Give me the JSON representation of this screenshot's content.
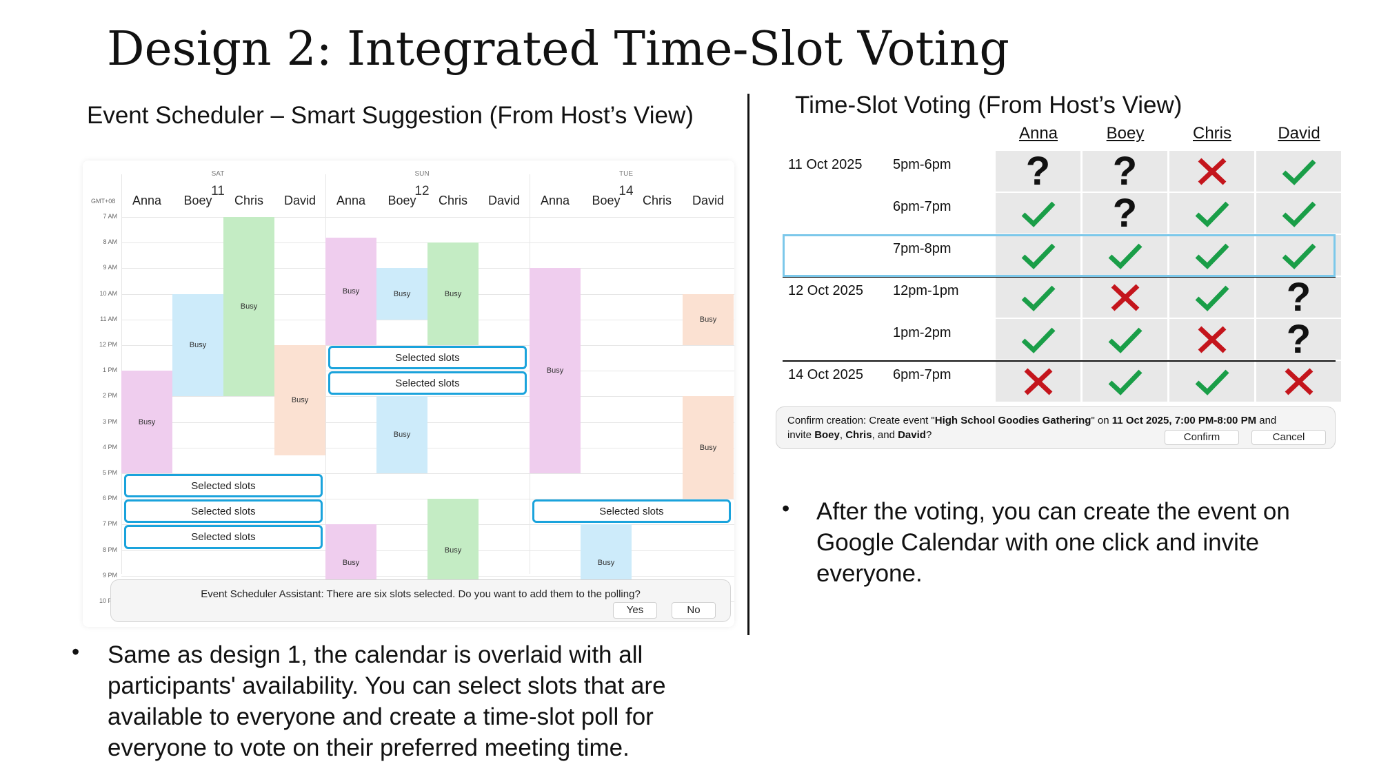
{
  "slide_title": "Design 2: Integrated Time-Slot Voting",
  "left_section": {
    "heading": "Event Scheduler – Smart Suggestion (From Host’s View)",
    "calendar": {
      "timezone": "GMT+08",
      "days": [
        {
          "weekday": "SAT",
          "date": "11"
        },
        {
          "weekday": "SUN",
          "date": "12"
        },
        {
          "weekday": "TUE",
          "date": "14"
        }
      ],
      "participants": [
        "Anna",
        "Boey",
        "Chris",
        "David"
      ],
      "hours": [
        "7 AM",
        "8 AM",
        "9 AM",
        "10 AM",
        "11 AM",
        "12 PM",
        "1 PM",
        "2 PM",
        "3 PM",
        "4 PM",
        "5 PM",
        "6 PM",
        "7 PM",
        "8 PM",
        "9 PM",
        "10 PM"
      ],
      "busy_label": "Busy",
      "selected_label": "Selected slots",
      "colors": {
        "Anna": "#efcdee",
        "Boey": "#cdebfa",
        "Chris": "#c4ecc4",
        "David": "#fbe1d2",
        "selected_border": "#1aa3dc"
      },
      "busy_blocks": [
        {
          "day": 0,
          "person": "Anna",
          "start": 13,
          "end": 17
        },
        {
          "day": 0,
          "person": "Boey",
          "start": 10,
          "end": 14
        },
        {
          "day": 0,
          "person": "Chris",
          "start": 7,
          "end": 14
        },
        {
          "day": 0,
          "person": "David",
          "start": 12,
          "end": 16.3
        },
        {
          "day": 1,
          "person": "Anna",
          "start": 7.8,
          "end": 12
        },
        {
          "day": 1,
          "person": "Boey",
          "start": 9,
          "end": 11
        },
        {
          "day": 1,
          "person": "Chris",
          "start": 8,
          "end": 12
        },
        {
          "day": 1,
          "person": "Boey",
          "start": 14,
          "end": 17
        },
        {
          "day": 1,
          "person": "Anna",
          "start": 19,
          "end": 22
        },
        {
          "day": 1,
          "person": "Chris",
          "start": 18,
          "end": 22
        },
        {
          "day": 2,
          "person": "Anna",
          "start": 9,
          "end": 17
        },
        {
          "day": 2,
          "person": "David",
          "start": 10,
          "end": 12
        },
        {
          "day": 2,
          "person": "David",
          "start": 14,
          "end": 18
        },
        {
          "day": 2,
          "person": "Boey",
          "start": 19,
          "end": 22
        }
      ],
      "selected_slots": [
        {
          "day": 0,
          "start": 17,
          "end": 18
        },
        {
          "day": 0,
          "start": 18,
          "end": 19
        },
        {
          "day": 0,
          "start": 19,
          "end": 20
        },
        {
          "day": 1,
          "start": 12,
          "end": 13
        },
        {
          "day": 1,
          "start": 13,
          "end": 14
        },
        {
          "day": 2,
          "start": 18,
          "end": 19
        }
      ],
      "assistant": {
        "message": "Event Scheduler Assistant: There are six slots selected. Do you want to add them to the polling?",
        "yes": "Yes",
        "no": "No"
      }
    },
    "bullet": "Same as design 1, the calendar is overlaid with all participants' availability. You can select slots that are available to everyone and create a time-slot poll for everyone to vote on their preferred meeting time."
  },
  "right_section": {
    "heading": "Time-Slot Voting (From Host’s View)",
    "columns": [
      "Anna",
      "Boey",
      "Chris",
      "David"
    ],
    "rows": [
      {
        "date": "11 Oct 2025",
        "time": "5pm-6pm",
        "votes": [
          "maybe",
          "maybe",
          "no",
          "yes"
        ]
      },
      {
        "date": "",
        "time": "6pm-7pm",
        "votes": [
          "yes",
          "maybe",
          "yes",
          "yes"
        ]
      },
      {
        "date": "",
        "time": "7pm-8pm",
        "votes": [
          "yes",
          "yes",
          "yes",
          "yes"
        ],
        "highlighted": true
      },
      {
        "date": "12 Oct 2025",
        "time": "12pm-1pm",
        "votes": [
          "yes",
          "no",
          "yes",
          "maybe"
        ]
      },
      {
        "date": "",
        "time": "1pm-2pm",
        "votes": [
          "yes",
          "yes",
          "no",
          "maybe"
        ]
      },
      {
        "date": "14 Oct 2025",
        "time": "6pm-7pm",
        "votes": [
          "no",
          "yes",
          "yes",
          "no"
        ]
      }
    ],
    "vote_colors": {
      "yes": "#1a9e48",
      "no": "#c4151c",
      "maybe": "#111111"
    },
    "confirm": {
      "prefix": "Confirm creation: Create event \"",
      "event_name": "High School Goodies Gathering",
      "mid": "\" on ",
      "when": "11 Oct 2025, 7:00 PM-8:00 PM",
      "and_invite": " and",
      "invite_prefix": "invite ",
      "invitee1": "Boey",
      "sep1": ", ",
      "invitee2": "Chris",
      "sep2": ", and ",
      "invitee3": "David",
      "suffix": "?",
      "confirm_label": "Confirm",
      "cancel_label": "Cancel"
    },
    "bullet": "After the voting, you can create the event on Google Calendar with one click and invite everyone."
  }
}
